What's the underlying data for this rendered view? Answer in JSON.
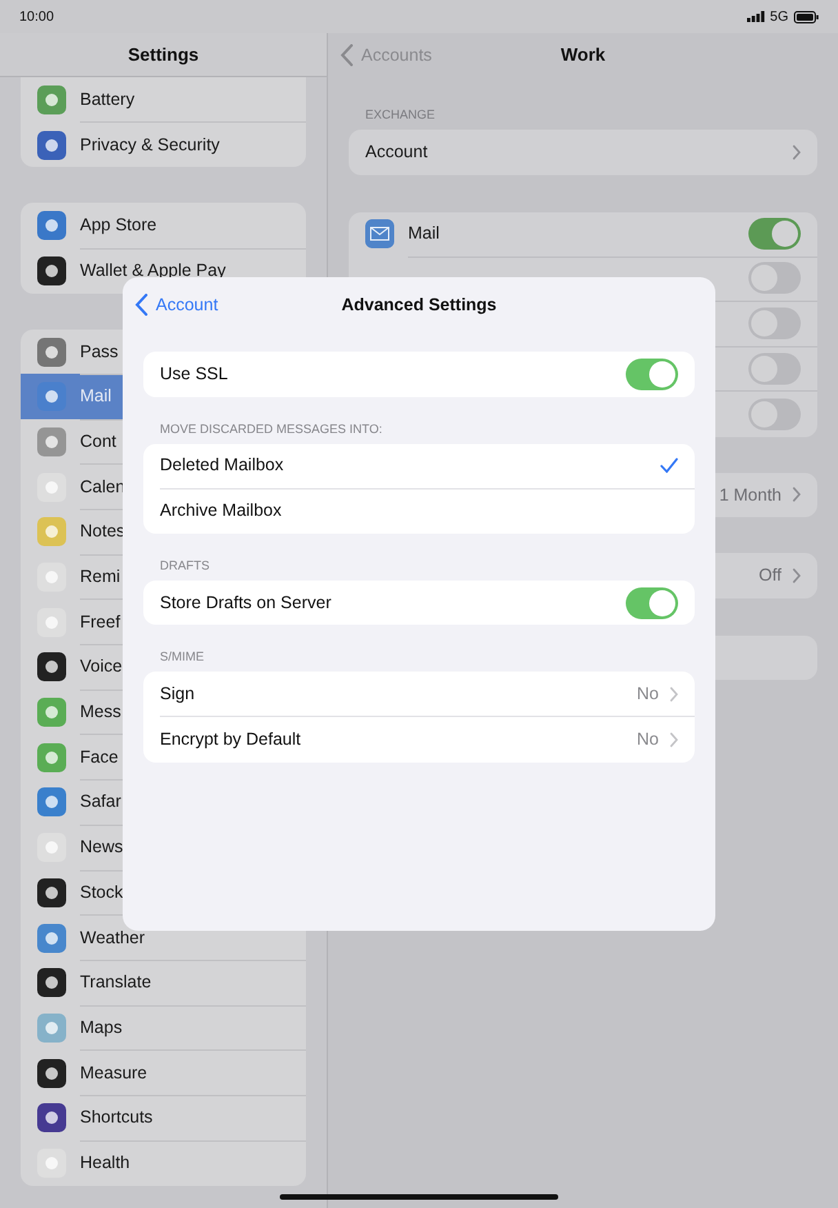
{
  "status_bar": {
    "time": "10:00",
    "network": "5G"
  },
  "sidebar": {
    "title": "Settings",
    "groups": [
      {
        "items": [
          {
            "label": "Battery",
            "color": "#5b9e58",
            "selected": false
          },
          {
            "label": "Privacy & Security",
            "color": "#3b62b8",
            "selected": false
          }
        ]
      },
      {
        "items": [
          {
            "label": "App Store",
            "color": "#3a78c8",
            "selected": false
          },
          {
            "label": "Wallet & Apple Pay",
            "color": "#222222",
            "selected": false
          }
        ]
      },
      {
        "items": [
          {
            "label": "Pass",
            "color": "#757575",
            "selected": false
          },
          {
            "label": "Mail",
            "color": "#4a80cc",
            "selected": true
          },
          {
            "label": "Cont",
            "color": "#959595",
            "selected": false
          },
          {
            "label": "Calen",
            "color": "#dedede",
            "selected": false
          },
          {
            "label": "Notes",
            "color": "#dcc255",
            "selected": false
          },
          {
            "label": "Remi",
            "color": "#dedede",
            "selected": false
          },
          {
            "label": "Freef",
            "color": "#dedede",
            "selected": false
          },
          {
            "label": "Voice",
            "color": "#222222",
            "selected": false
          },
          {
            "label": "Mess",
            "color": "#5aad55",
            "selected": false
          },
          {
            "label": "Face",
            "color": "#5aad55",
            "selected": false
          },
          {
            "label": "Safar",
            "color": "#3a80cc",
            "selected": false
          },
          {
            "label": "News",
            "color": "#dedede",
            "selected": false
          },
          {
            "label": "Stock",
            "color": "#222222",
            "selected": false
          },
          {
            "label": "Weather",
            "color": "#4887cc",
            "selected": false
          },
          {
            "label": "Translate",
            "color": "#222222",
            "selected": false
          },
          {
            "label": "Maps",
            "color": "#86b2c9",
            "selected": false
          },
          {
            "label": "Measure",
            "color": "#222222",
            "selected": false
          },
          {
            "label": "Shortcuts",
            "color": "#463a92",
            "selected": false
          },
          {
            "label": "Health",
            "color": "#dedede",
            "selected": false
          }
        ]
      }
    ]
  },
  "detail": {
    "back": "Accounts",
    "title": "Work",
    "section": "EXCHANGE",
    "account_row": "Account",
    "services": [
      {
        "label": "Mail",
        "on": true
      },
      {
        "on": false
      },
      {
        "on": false
      },
      {
        "on": false
      },
      {
        "on": false
      }
    ],
    "value_rows": [
      {
        "value": "1 Month"
      },
      {
        "value": "Off"
      }
    ]
  },
  "modal": {
    "back": "Account",
    "title": "Advanced Settings",
    "sections": [
      {
        "rows": [
          {
            "kind": "toggle",
            "label": "Use SSL",
            "on": true
          }
        ]
      },
      {
        "header": "MOVE DISCARDED MESSAGES INTO:",
        "rows": [
          {
            "kind": "check",
            "label": "Deleted Mailbox",
            "selected": true
          },
          {
            "kind": "check",
            "label": "Archive Mailbox",
            "selected": false
          }
        ]
      },
      {
        "header": "DRAFTS",
        "rows": [
          {
            "kind": "toggle",
            "label": "Store Drafts on Server",
            "on": true
          }
        ]
      },
      {
        "header": "S/MIME",
        "rows": [
          {
            "kind": "disclosure",
            "label": "Sign",
            "value": "No"
          },
          {
            "kind": "disclosure",
            "label": "Encrypt by Default",
            "value": "No"
          }
        ]
      }
    ]
  }
}
